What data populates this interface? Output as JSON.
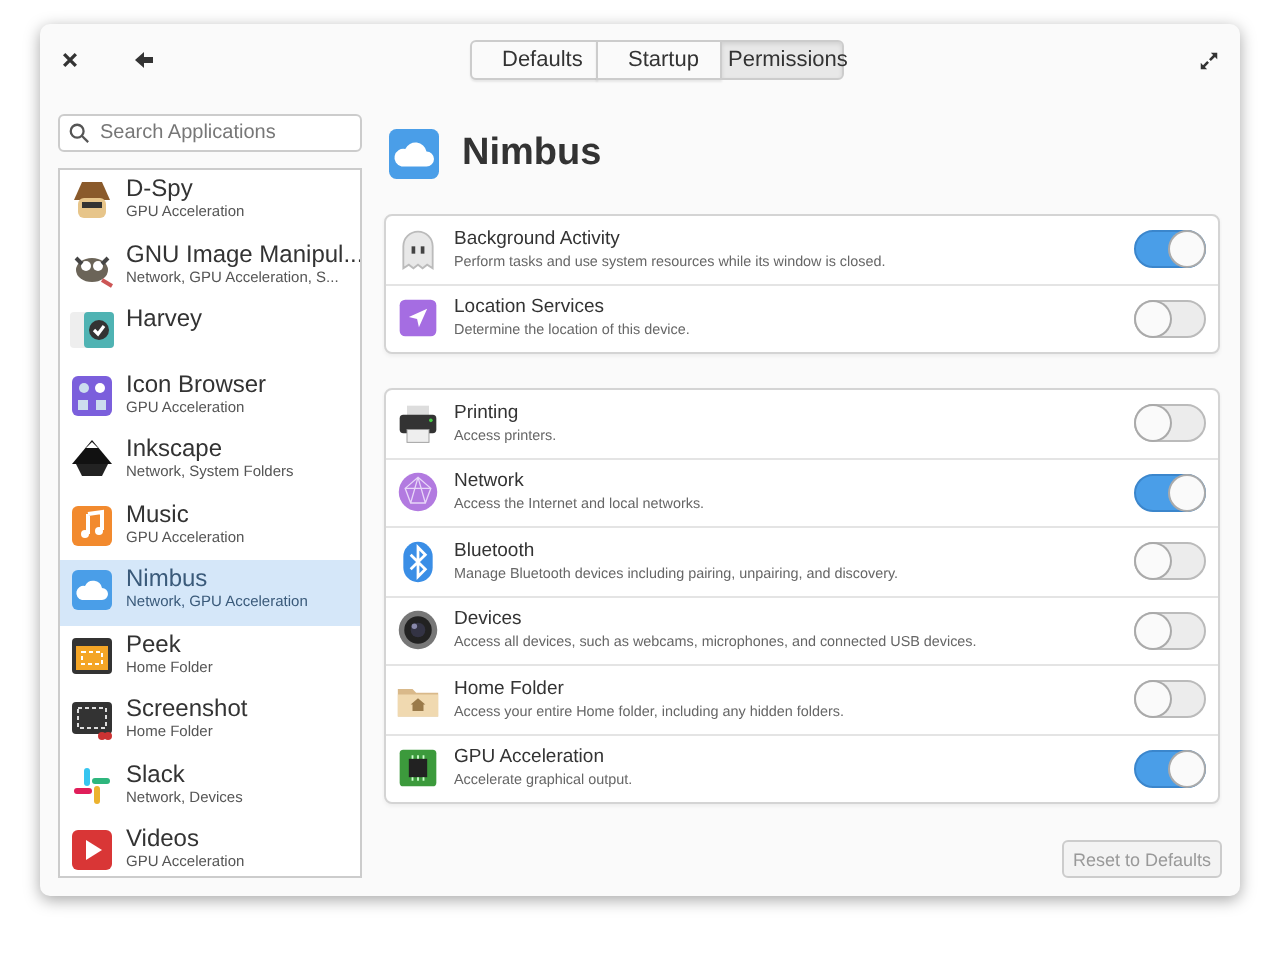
{
  "window": {
    "tabs": [
      {
        "label": "Defaults",
        "selected": false
      },
      {
        "label": "Startup",
        "selected": false
      },
      {
        "label": "Permissions",
        "selected": true
      }
    ]
  },
  "sidebar": {
    "search": {
      "placeholder": "Search Applications"
    },
    "apps": [
      {
        "name": "D-Spy",
        "permissions": "GPU Acceleration",
        "selected": false
      },
      {
        "name": "GNU Image Manipul...",
        "permissions": "Network, GPU Acceleration, S...",
        "selected": false
      },
      {
        "name": "Harvey",
        "selected": false
      },
      {
        "name": "Icon Browser",
        "permissions": "GPU Acceleration",
        "selected": false
      },
      {
        "name": "Inkscape",
        "permissions": "Network, System Folders",
        "selected": false
      },
      {
        "name": "Music",
        "permissions": "GPU Acceleration",
        "selected": false
      },
      {
        "name": "Nimbus",
        "permissions": "Network, GPU Acceleration",
        "selected": true
      },
      {
        "name": "Peek",
        "permissions": "Home Folder",
        "selected": false
      },
      {
        "name": "Screenshot",
        "permissions": "Home Folder",
        "selected": false
      },
      {
        "name": "Slack",
        "permissions": "Network, Devices",
        "selected": false
      },
      {
        "name": "Videos",
        "permissions": "GPU Acceleration",
        "selected": false
      }
    ]
  },
  "app_title": "Nimbus",
  "permission_groups": [
    {
      "items": [
        {
          "title": "Background Activity",
          "description": "Perform tasks and use system resources while its window is closed.",
          "on": true
        },
        {
          "title": "Location Services",
          "description": "Determine the location of this device.",
          "on": false
        }
      ]
    },
    {
      "items": [
        {
          "title": "Printing",
          "description": "Access printers.",
          "on": false
        },
        {
          "title": "Network",
          "description": "Access the Internet and local networks.",
          "on": true
        },
        {
          "title": "Bluetooth",
          "description": "Manage Bluetooth devices including pairing, unpairing, and discovery.",
          "on": false
        },
        {
          "title": "Devices",
          "description": "Access all devices, such as webcams, microphones, and connected USB devices.",
          "on": false
        },
        {
          "title": "Home Folder",
          "description": "Access your entire Home folder, including any hidden folders.",
          "on": false
        },
        {
          "title": "GPU Acceleration",
          "description": "Accelerate graphical output.",
          "on": true
        }
      ]
    }
  ],
  "reset_button": "Reset to Defaults"
}
